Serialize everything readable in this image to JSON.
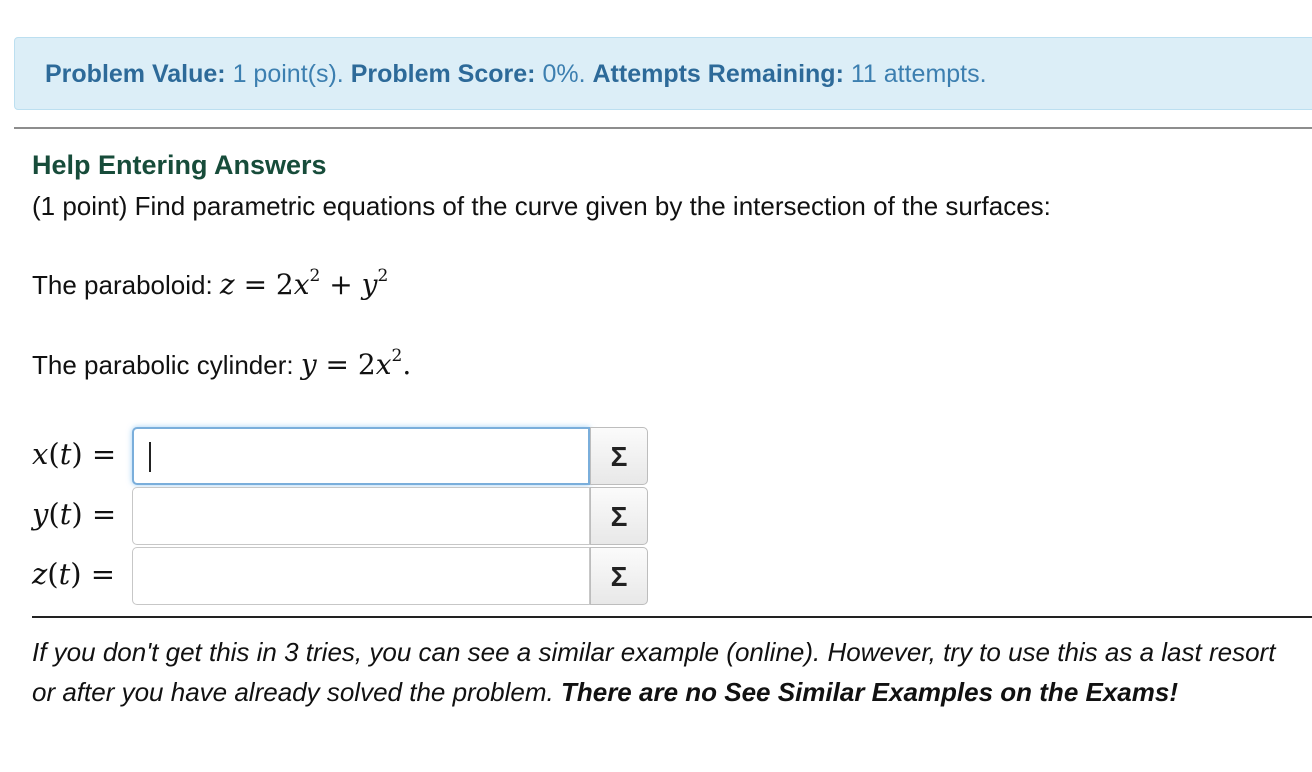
{
  "status": {
    "value_label": "Problem Value:",
    "value_text": "1 point(s).",
    "score_label": "Problem Score:",
    "score_text": "0%.",
    "attempts_label": "Attempts Remaining:",
    "attempts_text": "11 attempts."
  },
  "problem": {
    "help_link": "Help Entering Answers",
    "intro": "(1 point) Find parametric equations of the curve given by the intersection of the surfaces:",
    "paraboloid_label": "The paraboloid: ",
    "cylinder_label": "The parabolic cylinder: "
  },
  "answers": [
    {
      "label_var": "x",
      "value": "",
      "focused": true
    },
    {
      "label_var": "y",
      "value": "",
      "focused": false
    },
    {
      "label_var": "z",
      "value": "",
      "focused": false
    }
  ],
  "equation_editor_symbol": "Σ",
  "footer": {
    "italic_text": "If you don't get this in 3 tries, you can see a similar example (online). However, try to use this as a last resort or after you have already solved the problem. ",
    "bold_text": "There are no See Similar Examples on the Exams!"
  },
  "colors": {
    "status_bg": "#dceef7",
    "status_text": "#2d6a99",
    "help_link": "#174c3a"
  },
  "icons": {
    "equation_editor": "sigma-icon"
  }
}
